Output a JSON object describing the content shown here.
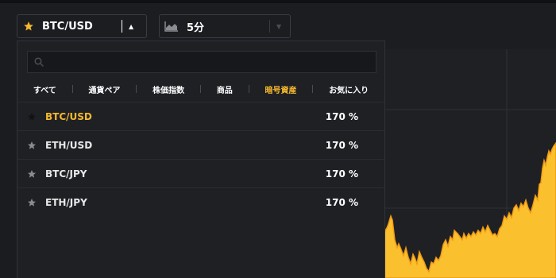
{
  "header": {
    "asset_select": {
      "label": "BTC/USD",
      "icon": "star-icon",
      "caret": "▲"
    },
    "interval_select": {
      "label": "5分",
      "icon": "area-chart-icon",
      "caret": "▼"
    }
  },
  "dropdown": {
    "search": {
      "placeholder": "",
      "value": ""
    },
    "tabs": [
      {
        "label": "すべて"
      },
      {
        "label": "通貨ペア"
      },
      {
        "label": "株価指数"
      },
      {
        "label": "商品"
      },
      {
        "label": "暗号資産"
      },
      {
        "label": "お気に入り"
      }
    ],
    "active_tab": "暗号資産",
    "assets": [
      {
        "name": "BTC/USD",
        "payout": "170 %",
        "selected": true
      },
      {
        "name": "ETH/USD",
        "payout": "170 %",
        "selected": false
      },
      {
        "name": "BTC/JPY",
        "payout": "170 %",
        "selected": false
      },
      {
        "name": "ETH/JPY",
        "payout": "170 %",
        "selected": false
      }
    ]
  },
  "colors": {
    "accent": "#f5b82e",
    "chart_fill": "#fbc02d",
    "background": "#1b1c20",
    "panel": "#1f2024"
  }
}
